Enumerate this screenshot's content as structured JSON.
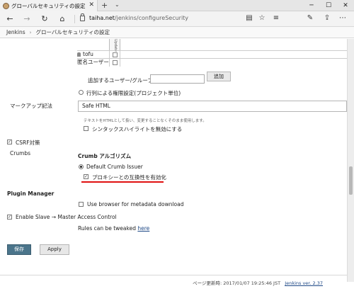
{
  "browser": {
    "tab_title": "グローバルセキュリティの設定",
    "tab_close": "✕",
    "new_tab": "+",
    "tab_dropdown": "⌄",
    "window_minimize": "─",
    "window_maximize": "☐",
    "window_close": "✕",
    "nav_back": "←",
    "nav_forward": "→",
    "nav_refresh": "↻",
    "nav_home": "⌂",
    "url_host": "taiha.net",
    "url_path": "/jenkins/configureSecurity",
    "toolbar_icons": [
      "reading-view-icon",
      "favorite-star-icon",
      "favorites-hub-icon",
      "notes-icon",
      "share-icon",
      "more-icon"
    ]
  },
  "breadcrumb": {
    "root": "Jenkins",
    "separator": "›",
    "current": "グローバルセキュリティの設定"
  },
  "matrix": {
    "column_header": "Update",
    "rows": [
      {
        "name": "tofu"
      },
      {
        "name": "匿名ユーザー"
      }
    ]
  },
  "add_user": {
    "label": "追加するユーザー/グループ:",
    "value": "",
    "button": "追加"
  },
  "project_matrix": {
    "label": "行列による権限設定(プロジェクト単位)"
  },
  "markup": {
    "label": "マークアップ記法",
    "selected": "Safe HTML",
    "help": "テキストをHTMLとして扱い、変更することなくそのまま使用します。",
    "syntax_label": "シンタックスハイライトを無効にする"
  },
  "csrf": {
    "label": "CSRF対策",
    "crumbs_label": "Crumbs",
    "algorithm_label": "Crumb アルゴリズム",
    "issuer_label": "Default Crumb Issuer",
    "proxy_label": "プロキシーとの互換性を有効化"
  },
  "plugin_manager": {
    "title": "Plugin Manager",
    "metadata_label": "Use browser for metadata download"
  },
  "slave": {
    "label": "Enable Slave → Master Access Control",
    "rules_text": "Rules can be tweaked",
    "rules_link": "here"
  },
  "actions": {
    "save": "保存",
    "apply": "Apply"
  },
  "footer": {
    "updated": "ページ更新時: 2017/01/07 19:25:46 JST",
    "version_link": "Jenkins ver. 2.37"
  },
  "colors": {
    "save_button": "#4b758b",
    "highlight_underline": "#e01010",
    "link": "#204a87"
  }
}
